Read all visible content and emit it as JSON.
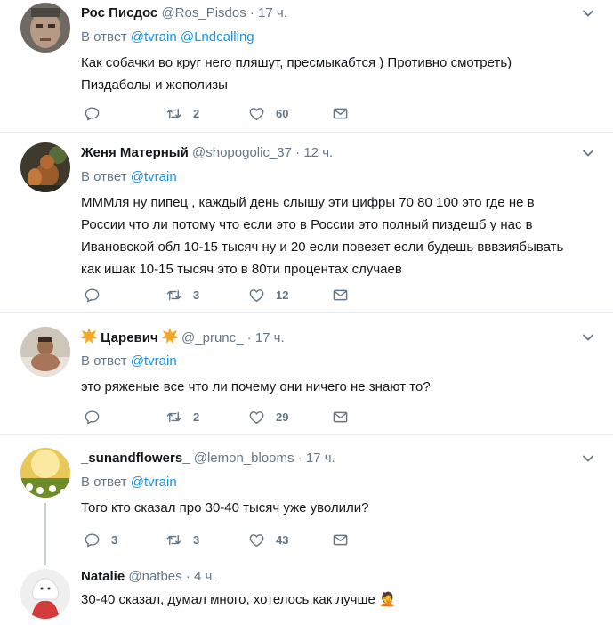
{
  "reply_prefix": "В ответ",
  "tweets": [
    {
      "name": "Рос Писдос",
      "handle": "@Ros_Pisdos",
      "dot": "·",
      "time": "17 ч.",
      "mentions": [
        "@tvrain",
        "@Lndcalling"
      ],
      "text": "Как собачки во круг него пляшут, пресмыкабтся ) Противно смотреть)\nПиздаболы и жополизы",
      "replies": "",
      "retweets": "2",
      "likes": "60"
    },
    {
      "name": "Женя Матерный",
      "handle": "@shopogolic_37",
      "dot": "·",
      "time": "12 ч.",
      "mentions": [
        "@tvrain"
      ],
      "text": "МММля ну пипец , каждый день слышу эти цифры 70 80 100 это где  не в\nРоссии что ли потому что если это в России это полный пиздешб у нас в\nИвановской обл 10-15 тысяч ну и 20 если повезет если будешь вввзиябывать\nкак ишак  10-15 тысяч это в 80ти процентах случаев",
      "replies": "",
      "retweets": "3",
      "likes": "12"
    },
    {
      "name": "Царевич",
      "handle": "@_prunc_",
      "dot": "·",
      "time": "17 ч.",
      "mentions": [
        "@tvrain"
      ],
      "text": "это ряженые все что ли почему они ничего не знают то?",
      "replies": "",
      "retweets": "2",
      "likes": "29"
    },
    {
      "name": "_sunandflowers_",
      "handle": "@lemon_blooms",
      "dot": "·",
      "time": "17 ч.",
      "mentions": [
        "@tvrain"
      ],
      "text": "Того кто сказал про 30-40 тысяч уже уволили?",
      "replies": "3",
      "retweets": "3",
      "likes": "43"
    },
    {
      "name": "Natalie",
      "handle": "@natbes",
      "dot": "·",
      "time": "4 ч.",
      "text": "30-40 сказал, думал много, хотелось как лучше 🤦"
    }
  ],
  "icons": {
    "reply": "reply-icon",
    "retweet": "retweet-icon",
    "like": "heart-icon",
    "dm": "envelope-icon",
    "menu": "chevron-down-icon"
  },
  "colors": {
    "mention": "#1b95e0",
    "secondary": "#657786",
    "border": "#e6ecf0"
  }
}
